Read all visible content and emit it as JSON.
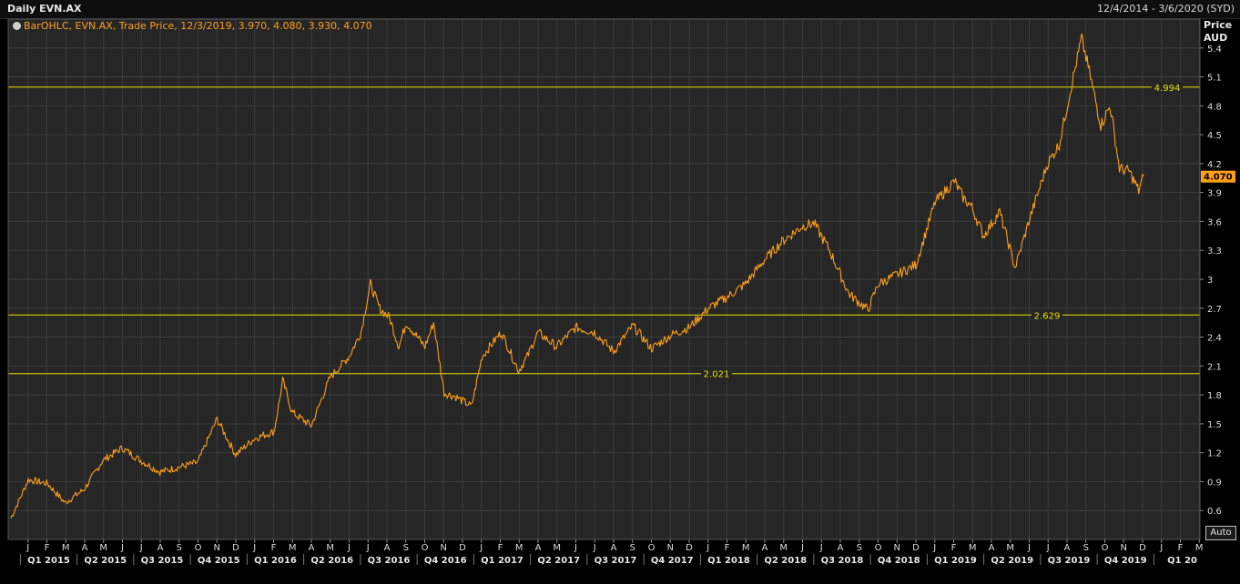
{
  "header": {
    "title": "Daily EVN.AX",
    "date_range": "12/4/2014 - 3/6/2020 (SYD)"
  },
  "legend": {
    "text": "BarOHLC, EVN.AX, Trade Price, 12/3/2019, 3.970, 4.080, 3.930, 4.070"
  },
  "axis": {
    "title_line1": "Price",
    "title_line2": "AUD",
    "auto_label": "Auto"
  },
  "colors": {
    "background": "#262626",
    "grid": "#3a3a3a",
    "series": "#ff9f1a",
    "level_line": "#e8e000",
    "last_price_tag": "#ff9f1a"
  },
  "chart_data": {
    "type": "line",
    "title": "Daily EVN.AX",
    "ylabel": "Price AUD",
    "ylim": [
      0.3,
      5.7
    ],
    "yticks": [
      0.6,
      0.9,
      1.2,
      1.5,
      1.8,
      2.1,
      2.4,
      2.7,
      3.0,
      3.3,
      3.6,
      3.9,
      4.2,
      4.5,
      4.8,
      5.1,
      5.4
    ],
    "ytick_labels": [
      "0.6",
      "0.9",
      "1.2",
      "1.5",
      "1.8",
      "2.1",
      "2.4",
      "2.7",
      "3",
      "3.3",
      "3.6",
      "3.9",
      "4.2",
      "4.5",
      "4.8",
      "5.1",
      "5.4"
    ],
    "x_month_labels": [
      "J",
      "F",
      "M",
      "A",
      "M",
      "J",
      "J",
      "A",
      "S",
      "O",
      "N",
      "D",
      "J",
      "F",
      "M",
      "A",
      "M",
      "J",
      "J",
      "A",
      "S",
      "O",
      "N",
      "D",
      "J",
      "F",
      "M",
      "A",
      "M",
      "J",
      "J",
      "A",
      "S",
      "O",
      "N",
      "D",
      "J",
      "F",
      "M",
      "A",
      "M",
      "J",
      "J",
      "A",
      "S",
      "O",
      "N",
      "D",
      "J",
      "F",
      "M",
      "A",
      "M",
      "J",
      "J",
      "A",
      "S",
      "O",
      "N",
      "D",
      "J",
      "F",
      "M"
    ],
    "x_quarter_labels": [
      "Q1 2015",
      "Q2 2015",
      "Q3 2015",
      "Q4 2015",
      "Q1 2016",
      "Q2 2016",
      "Q3 2016",
      "Q4 2016",
      "Q1 2017",
      "Q2 2017",
      "Q3 2017",
      "Q4 2017",
      "Q1 2018",
      "Q2 2018",
      "Q3 2018",
      "Q4 2018",
      "Q1 2019",
      "Q2 2019",
      "Q3 2019",
      "Q4 2019",
      "Q1 20"
    ],
    "level_lines": [
      {
        "value": 4.994,
        "label": "4.994"
      },
      {
        "value": 2.629,
        "label": "2.629"
      },
      {
        "value": 2.021,
        "label": "2.021"
      }
    ],
    "last_price": {
      "value": 4.07,
      "label": "4.070"
    },
    "series": [
      {
        "name": "EVN.AX",
        "x": [
          "2014-12-04",
          "2015-01-01",
          "2015-02-01",
          "2015-03-01",
          "2015-04-01",
          "2015-05-01",
          "2015-06-01",
          "2015-07-01",
          "2015-08-01",
          "2015-09-01",
          "2015-10-01",
          "2015-11-01",
          "2015-12-01",
          "2016-01-01",
          "2016-02-01",
          "2016-02-15",
          "2016-03-01",
          "2016-04-01",
          "2016-05-01",
          "2016-06-01",
          "2016-06-20",
          "2016-07-05",
          "2016-07-20",
          "2016-08-05",
          "2016-08-20",
          "2016-09-01",
          "2016-10-01",
          "2016-10-15",
          "2016-11-01",
          "2016-11-20",
          "2016-12-15",
          "2017-01-01",
          "2017-02-01",
          "2017-03-01",
          "2017-03-15",
          "2017-04-01",
          "2017-05-01",
          "2017-06-01",
          "2017-07-01",
          "2017-08-01",
          "2017-09-01",
          "2017-10-01",
          "2017-11-01",
          "2017-12-01",
          "2018-01-01",
          "2018-02-01",
          "2018-03-01",
          "2018-04-01",
          "2018-05-01",
          "2018-06-01",
          "2018-06-20",
          "2018-07-15",
          "2018-08-15",
          "2018-09-15",
          "2018-10-01",
          "2018-11-01",
          "2018-12-01",
          "2019-01-01",
          "2019-02-01",
          "2019-02-15",
          "2019-03-01",
          "2019-03-20",
          "2019-04-15",
          "2019-05-10",
          "2019-06-01",
          "2019-07-01",
          "2019-07-20",
          "2019-08-10",
          "2019-08-25",
          "2019-09-10",
          "2019-09-25",
          "2019-10-10",
          "2019-10-25",
          "2019-11-10",
          "2019-11-25",
          "2019-12-03"
        ],
        "y": [
          0.52,
          0.92,
          0.88,
          0.68,
          0.82,
          1.12,
          1.25,
          1.12,
          1.0,
          1.05,
          1.1,
          1.55,
          1.18,
          1.35,
          1.42,
          1.95,
          1.62,
          1.48,
          1.98,
          2.2,
          2.45,
          2.95,
          2.7,
          2.6,
          2.3,
          2.55,
          2.3,
          2.55,
          1.82,
          1.78,
          1.68,
          2.2,
          2.45,
          2.05,
          2.2,
          2.45,
          2.3,
          2.5,
          2.45,
          2.25,
          2.52,
          2.28,
          2.42,
          2.5,
          2.7,
          2.82,
          2.95,
          3.2,
          3.4,
          3.55,
          3.58,
          3.3,
          2.85,
          2.68,
          2.95,
          3.05,
          3.15,
          3.8,
          4.02,
          3.85,
          3.75,
          3.45,
          3.7,
          3.12,
          3.6,
          4.2,
          4.4,
          5.05,
          5.5,
          5.05,
          4.6,
          4.8,
          4.15,
          4.12,
          3.92,
          4.07
        ]
      }
    ]
  }
}
